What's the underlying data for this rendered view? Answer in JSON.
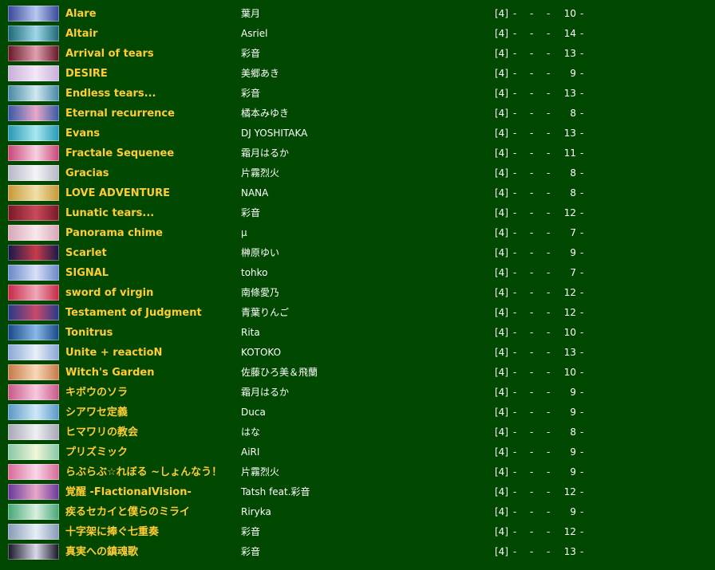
{
  "songs": [
    {
      "title": "Alare",
      "artist": "葉月",
      "level": "[4]",
      "col1": "-",
      "col2": "-",
      "col3": "-",
      "rating": "10",
      "col5": "-",
      "banner_colors": [
        "#3a4a9a",
        "#b8c8f0"
      ]
    },
    {
      "title": "Altair",
      "artist": "Asriel",
      "level": "[4]",
      "col1": "-",
      "col2": "-",
      "col3": "-",
      "rating": "14",
      "col5": "-",
      "banner_colors": [
        "#1f6a7a",
        "#9fd8e8"
      ]
    },
    {
      "title": "Arrival of tears",
      "artist": "彩音",
      "level": "[4]",
      "col1": "-",
      "col2": "-",
      "col3": "-",
      "rating": "13",
      "col5": "-",
      "banner_colors": [
        "#6a1a2a",
        "#e0a0b0"
      ]
    },
    {
      "title": "DESIRE",
      "artist": "美郷あき",
      "level": "[4]",
      "col1": "-",
      "col2": "-",
      "col3": "-",
      "rating": "9",
      "col5": "-",
      "banner_colors": [
        "#c8b0d8",
        "#f4e8f8"
      ]
    },
    {
      "title": "Endless tears...",
      "artist": "彩音",
      "level": "[4]",
      "col1": "-",
      "col2": "-",
      "col3": "-",
      "rating": "13",
      "col5": "-",
      "banner_colors": [
        "#4a8aa8",
        "#d0e8f0"
      ]
    },
    {
      "title": "Eternal recurrence",
      "artist": "橘本みゆき",
      "level": "[4]",
      "col1": "-",
      "col2": "-",
      "col3": "-",
      "rating": "8",
      "col5": "-",
      "banner_colors": [
        "#3a5aa8",
        "#e8a8c8"
      ]
    },
    {
      "title": "Evans",
      "artist": "DJ YOSHITAKA",
      "level": "[4]",
      "col1": "-",
      "col2": "-",
      "col3": "-",
      "rating": "13",
      "col5": "-",
      "banner_colors": [
        "#2a9ab8",
        "#a8e8f0"
      ]
    },
    {
      "title": "Fractale Sequenee",
      "artist": "霜月はるか",
      "level": "[4]",
      "col1": "-",
      "col2": "-",
      "col3": "-",
      "rating": "11",
      "col5": "-",
      "banner_colors": [
        "#c84a7a",
        "#f8d0e0"
      ]
    },
    {
      "title": "Gracias",
      "artist": "片霧烈火",
      "level": "[4]",
      "col1": "-",
      "col2": "-",
      "col3": "-",
      "rating": "8",
      "col5": "-",
      "banner_colors": [
        "#b8b8c8",
        "#f4f4f8"
      ]
    },
    {
      "title": "LOVE ADVENTURE",
      "artist": "NANA",
      "level": "[4]",
      "col1": "-",
      "col2": "-",
      "col3": "-",
      "rating": "8",
      "col5": "-",
      "banner_colors": [
        "#c89a3a",
        "#f0e0a8"
      ]
    },
    {
      "title": "Lunatic tears...",
      "artist": "彩音",
      "level": "[4]",
      "col1": "-",
      "col2": "-",
      "col3": "-",
      "rating": "12",
      "col5": "-",
      "banner_colors": [
        "#7a1a2a",
        "#c84a5a"
      ]
    },
    {
      "title": "Panorama chime",
      "artist": "μ",
      "level": "[4]",
      "col1": "-",
      "col2": "-",
      "col3": "-",
      "rating": "7",
      "col5": "-",
      "banner_colors": [
        "#d8a8b8",
        "#f8e8ec"
      ]
    },
    {
      "title": "Scarlet",
      "artist": "榊原ゆい",
      "level": "[4]",
      "col1": "-",
      "col2": "-",
      "col3": "-",
      "rating": "9",
      "col5": "-",
      "banner_colors": [
        "#1a1a4a",
        "#c83a4a"
      ]
    },
    {
      "title": "SIGNAL",
      "artist": "tohko",
      "level": "[4]",
      "col1": "-",
      "col2": "-",
      "col3": "-",
      "rating": "7",
      "col5": "-",
      "banner_colors": [
        "#6a8ac8",
        "#d8e0f8"
      ]
    },
    {
      "title": "sword of virgin",
      "artist": "南條愛乃",
      "level": "[4]",
      "col1": "-",
      "col2": "-",
      "col3": "-",
      "rating": "12",
      "col5": "-",
      "banner_colors": [
        "#c82a4a",
        "#f0a8b8"
      ]
    },
    {
      "title": "Testament of Judgment",
      "artist": "青葉りんご",
      "level": "[4]",
      "col1": "-",
      "col2": "-",
      "col3": "-",
      "rating": "12",
      "col5": "-",
      "banner_colors": [
        "#2a3a8a",
        "#c84a6a"
      ]
    },
    {
      "title": "Tonitrus",
      "artist": "Rita",
      "level": "[4]",
      "col1": "-",
      "col2": "-",
      "col3": "-",
      "rating": "10",
      "col5": "-",
      "banner_colors": [
        "#1a4a8a",
        "#8ab8e8"
      ]
    },
    {
      "title": "Unite + reactioN",
      "artist": "KOTOKO",
      "level": "[4]",
      "col1": "-",
      "col2": "-",
      "col3": "-",
      "rating": "13",
      "col5": "-",
      "banner_colors": [
        "#8aa8d8",
        "#e8f0f8"
      ]
    },
    {
      "title": "Witch's Garden",
      "artist": "佐藤ひろ美＆飛蘭",
      "level": "[4]",
      "col1": "-",
      "col2": "-",
      "col3": "-",
      "rating": "10",
      "col5": "-",
      "banner_colors": [
        "#c87a4a",
        "#f8d8b8"
      ]
    },
    {
      "title": "キボウのソラ",
      "artist": "霜月はるか",
      "level": "[4]",
      "col1": "-",
      "col2": "-",
      "col3": "-",
      "rating": "9",
      "col5": "-",
      "banner_colors": [
        "#c85a8a",
        "#f8c8e0"
      ]
    },
    {
      "title": "シアワセ定義",
      "artist": "Duca",
      "level": "[4]",
      "col1": "-",
      "col2": "-",
      "col3": "-",
      "rating": "9",
      "col5": "-",
      "banner_colors": [
        "#5a9ac8",
        "#d0e8f8"
      ]
    },
    {
      "title": "ヒマワリの教会",
      "artist": "はな",
      "level": "[4]",
      "col1": "-",
      "col2": "-",
      "col3": "-",
      "rating": "8",
      "col5": "-",
      "banner_colors": [
        "#a8a8b8",
        "#f0f0f4"
      ]
    },
    {
      "title": "プリズミック",
      "artist": "AiRI",
      "level": "[4]",
      "col1": "-",
      "col2": "-",
      "col3": "-",
      "rating": "9",
      "col5": "-",
      "banner_colors": [
        "#8ac8a8",
        "#f0f8d8"
      ]
    },
    {
      "title": "らぶらぶ☆れぼる ~しょんなう！",
      "artist": "片霧烈火",
      "level": "[4]",
      "col1": "-",
      "col2": "-",
      "col3": "-",
      "rating": "9",
      "col5": "-",
      "banner_colors": [
        "#d86a9a",
        "#f8d8e8"
      ]
    },
    {
      "title": "覚醒 -FlactionalVision-",
      "artist": "Tatsh feat.彩音",
      "level": "[4]",
      "col1": "-",
      "col2": "-",
      "col3": "-",
      "rating": "12",
      "col5": "-",
      "banner_colors": [
        "#6a3a9a",
        "#e8a8c8"
      ]
    },
    {
      "title": "疾るセカイと僕らのミライ",
      "artist": "Riryka",
      "level": "[4]",
      "col1": "-",
      "col2": "-",
      "col3": "-",
      "rating": "9",
      "col5": "-",
      "banner_colors": [
        "#4aa87a",
        "#d8f0e0"
      ]
    },
    {
      "title": "十字架に捧ぐ七重奏",
      "artist": "彩音",
      "level": "[4]",
      "col1": "-",
      "col2": "-",
      "col3": "-",
      "rating": "12",
      "col5": "-",
      "banner_colors": [
        "#8a9ab8",
        "#e8eef8"
      ]
    },
    {
      "title": "真実への鎮魂歌",
      "artist": "彩音",
      "level": "[4]",
      "col1": "-",
      "col2": "-",
      "col3": "-",
      "rating": "13",
      "col5": "-",
      "banner_colors": [
        "#1a1a2a",
        "#d8d8e8"
      ]
    }
  ],
  "colors": {
    "background": "#004700",
    "title": "#ffcc33",
    "text": "#ffffff"
  }
}
